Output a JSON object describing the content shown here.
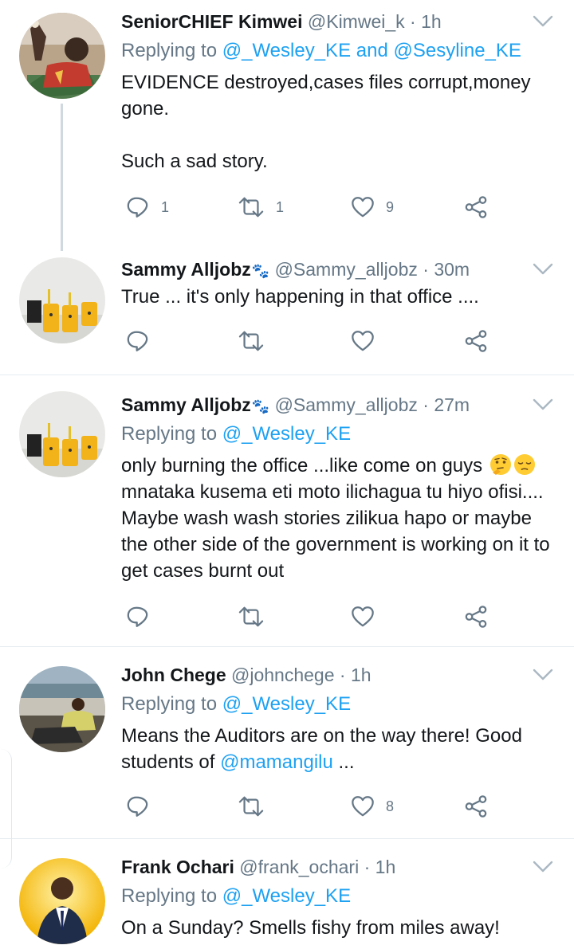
{
  "tweets": [
    {
      "name": "SeniorCHIEF Kimwei",
      "handle": "@Kimwei_k",
      "sep": "·",
      "time": "1h",
      "replying_prefix": "Replying to",
      "replying_to": "@_Wesley_KE",
      "replying_joiner": "and",
      "replying_to_2": "@Sesyline_KE",
      "text_1": "EVIDENCE destroyed,cases files corrupt,money gone.",
      "text_2": "Such a sad story.",
      "reply_count": "1",
      "retweet_count": "1",
      "like_count": "9"
    },
    {
      "name": "Sammy Alljobz",
      "badge": "🐾",
      "handle": "@Sammy_alljobz",
      "sep": "·",
      "time": "30m",
      "text_1": "True ... it's only happening in that office ...."
    },
    {
      "name": "Sammy Alljobz",
      "badge": "🐾",
      "handle": "@Sammy_alljobz",
      "sep": "·",
      "time": "27m",
      "replying_prefix": "Replying to",
      "replying_to": "@_Wesley_KE",
      "text_1": "only burning the office ...like come on guys",
      "text_2": "mnataka kusema eti moto ilichagua tu hiyo ofisi.... Maybe wash wash stories zilikua hapo or maybe the other side of the government is working on it to get cases burnt out",
      "emoji_1": "thinking-face",
      "emoji_2": "pensive-face"
    },
    {
      "name": "John Chege",
      "handle": "@johnchege",
      "sep": "·",
      "time": "1h",
      "replying_prefix": "Replying to",
      "replying_to": "@_Wesley_KE",
      "text_1": "Means the Auditors are on the way there! Good students of",
      "mention": "@mamangilu",
      "text_2": "...",
      "like_count": "8"
    },
    {
      "name": "Frank Ochari",
      "handle": "@frank_ochari",
      "sep": "·",
      "time": "1h",
      "replying_prefix": "Replying to",
      "replying_to": "@_Wesley_KE",
      "text_1": "On a Sunday? Smells fishy from miles away!"
    }
  ],
  "icons": {
    "reply": "reply-icon",
    "retweet": "retweet-icon",
    "like": "heart-icon",
    "share": "share-icon",
    "more": "chevron-down-icon"
  },
  "colors": {
    "link": "#1da1f2",
    "secondary_text": "#657786",
    "divider": "#e6ecf0",
    "badge": "#e0245e"
  }
}
